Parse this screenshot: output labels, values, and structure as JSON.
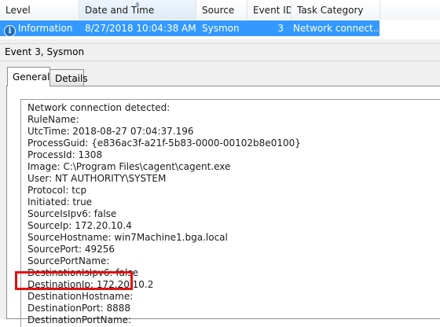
{
  "columns": [
    "Level",
    "Date and Time",
    "Source",
    "Event ID",
    "Task Category"
  ],
  "event_row": {
    "level": "Information",
    "date_time": "8/27/2018 10:04:38 AM",
    "source": "Sysmon",
    "event_id": "3",
    "task_category": "Network connect..."
  },
  "event_title": "Event 3, Sysmon",
  "tabs": [
    "General",
    "Details"
  ],
  "details": [
    "Network connection detected:",
    "RuleName:",
    "UtcTime: 2018-08-27 07:04:37.196",
    "ProcessGuid: {e836ac3f-a21f-5b83-0000-00102b8e0100}",
    "ProcessId: 1308",
    "Image: C:\\Program Files\\cagent\\cagent.exe",
    "User: NT AUTHORITY\\SYSTEM",
    "Protocol: tcp",
    "Initiated: true",
    "SourceIsIpv6: false",
    "SourceIp: 172.20.10.4",
    "SourceHostname: win7Machine1.bga.local",
    "SourcePort: 49256",
    "SourcePortName:",
    "DestinationIsIpv6: false",
    "DestinationIp: 172.20.10.2",
    "DestinationHostname:",
    "DestinationPort: 8888",
    "DestinationPortName:"
  ],
  "colors": {
    "selection": "#3399ff",
    "highlight_box": "#e41010",
    "info_icon": "#1e6fc4"
  },
  "icons": {
    "level": "info-icon",
    "sort": "sort-ascending-arrow"
  }
}
